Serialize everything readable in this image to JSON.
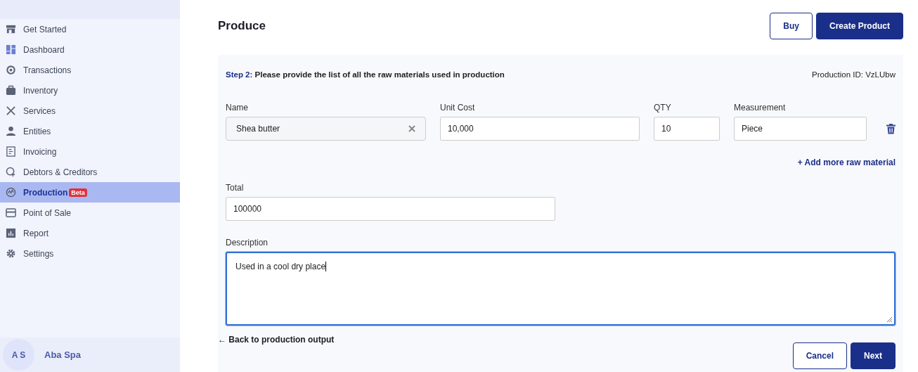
{
  "sidebar": {
    "items": [
      {
        "label": "Get Started",
        "selected": false
      },
      {
        "label": "Dashboard",
        "selected": false
      },
      {
        "label": "Transactions",
        "selected": false
      },
      {
        "label": "Inventory",
        "selected": false
      },
      {
        "label": "Services",
        "selected": false
      },
      {
        "label": "Entities",
        "selected": false
      },
      {
        "label": "Invoicing",
        "selected": false
      },
      {
        "label": "Debtors & Creditors",
        "selected": false
      },
      {
        "label": "Production",
        "selected": true,
        "badge": "Beta"
      },
      {
        "label": "Point of Sale",
        "selected": false
      },
      {
        "label": "Report",
        "selected": false
      },
      {
        "label": "Settings",
        "selected": false
      }
    ],
    "user": {
      "initials": "A S",
      "name": "Aba Spa"
    }
  },
  "header": {
    "title": "Produce",
    "buttons": [
      {
        "label": "Buy",
        "kind": "outline"
      },
      {
        "label": "Create Product",
        "kind": "primary"
      }
    ]
  },
  "form": {
    "step_label": "Step 2:",
    "step_text": "Please provide the list of all the raw materials used in production",
    "production_id": "Production ID: VzLUbw",
    "columns": [
      "Name",
      "Unit Cost",
      "QTY",
      "Measurement"
    ],
    "raw_materials": [
      {
        "name": "Shea butter",
        "unit_cost": "10,000",
        "qty": "10",
        "measurement": "Piece"
      }
    ],
    "add_link": "+ Add more raw material",
    "total": {
      "label": "Total",
      "value": "100000"
    },
    "description": {
      "label": "Description",
      "value": "Used in a cool dry place",
      "focused": true
    },
    "back_link": "← Back to production output",
    "buttons": [
      {
        "label": "Cancel",
        "kind": "outline"
      },
      {
        "label": "Next",
        "kind": "primary"
      }
    ]
  }
}
